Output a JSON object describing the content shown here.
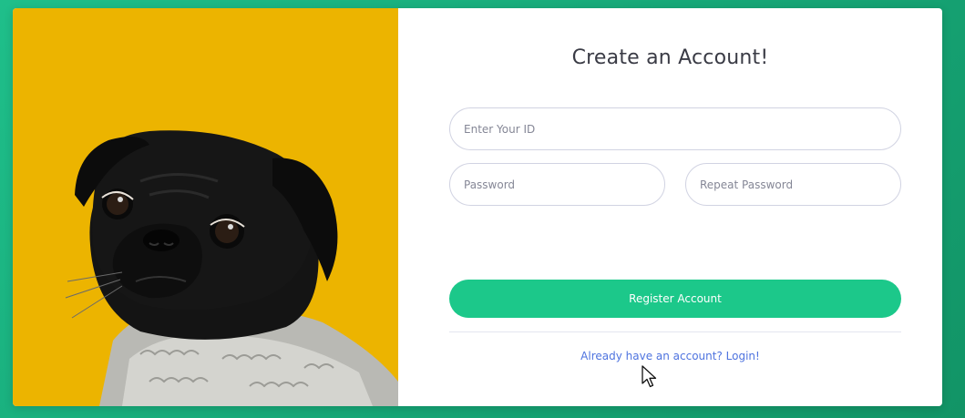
{
  "form": {
    "title": "Create an Account!",
    "id_placeholder": "Enter Your ID",
    "password_placeholder": "Password",
    "repeat_password_placeholder": "Repeat Password",
    "register_label": "Register Account",
    "login_link": "Already have an account? Login!"
  },
  "image": {
    "subject": "pug wearing knit sweater",
    "background_color": "#ecb400"
  },
  "colors": {
    "page_background": "#1abc87",
    "accent": "#1cc88a",
    "link": "#4e73df",
    "title_text": "#3a3b45"
  },
  "icons": {
    "cursor": "mouse-pointer-icon"
  }
}
